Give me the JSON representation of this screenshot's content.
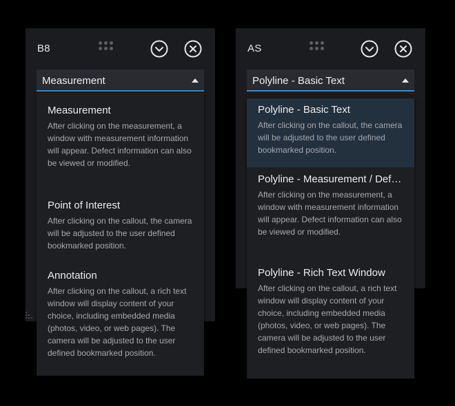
{
  "left_panel": {
    "title": "B8",
    "selected_value": "Measurement",
    "options": [
      {
        "title": "Measurement",
        "desc": "After clicking on the measurement, a window with measurement information will appear. Defect information can also be viewed or modified."
      },
      {
        "title": "Point of Interest",
        "desc": "After clicking on the callout, the camera will be adjusted to the user defined bookmarked position."
      },
      {
        "title": "Annotation",
        "desc": "After clicking on the callout, a rich text window will display content of your choice, including embedded media (photos, video, or web pages). The camera will be adjusted to the user defined bookmarked position."
      }
    ]
  },
  "right_panel": {
    "title": "AS",
    "selected_value": "Polyline - Basic Text",
    "options": [
      {
        "title": "Polyline - Basic Text",
        "desc": "After clicking on the callout, the camera will be adjusted to the user defined bookmarked position."
      },
      {
        "title": "Polyline - Measurement / Defect",
        "desc": "After clicking on the measurement, a window with measurement information will appear. Defect information can also be viewed or modified."
      },
      {
        "title": "Polyline - Rich Text Window",
        "desc": "After clicking on the callout, a rich text window will display content of your choice, including embedded media (photos, video, or web pages). The camera will be adjusted to the user defined bookmarked position."
      }
    ]
  },
  "icons": {
    "drag": "drag-handle-icon",
    "collapse": "chevron-down-circle-icon",
    "close": "close-circle-icon",
    "caret": "caret-up-icon",
    "resize": "resize-grip-icon"
  },
  "colors": {
    "panel_bg": "#1b1c1f",
    "select_bg": "#2a2b30",
    "accent_underline": "#3f87c6",
    "selected_option_bg": "#23303e"
  }
}
